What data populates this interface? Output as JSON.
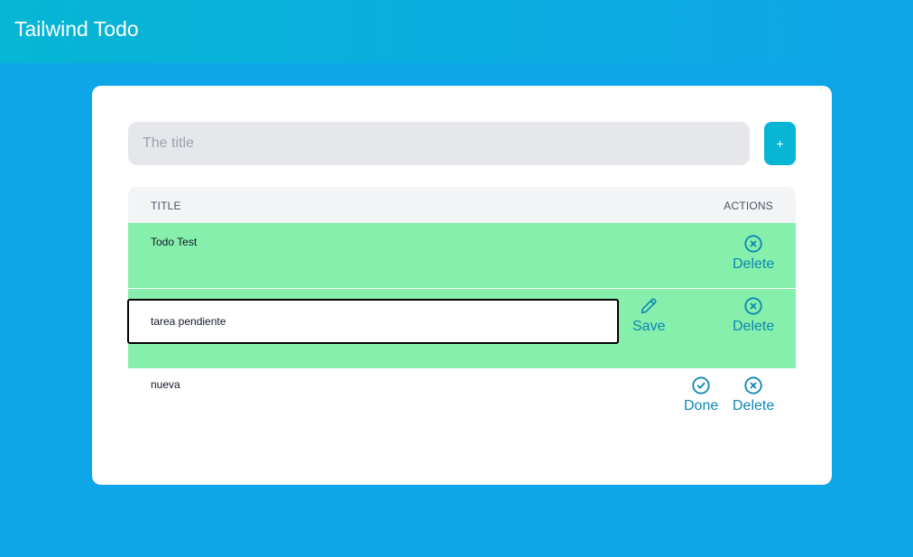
{
  "app": {
    "title": "Tailwind Todo"
  },
  "form": {
    "placeholder": "The title",
    "value": "",
    "add_label": "+"
  },
  "table": {
    "headers": {
      "title": "TITLE",
      "actions": "ACTIONS"
    },
    "rows": [
      {
        "title": "Todo Test",
        "status": "done",
        "delete_label": "Delete"
      },
      {
        "title": "tarea pendiente",
        "status": "editing",
        "save_label": "Save",
        "delete_label": "Delete"
      },
      {
        "title": "nueva",
        "status": "pending",
        "done_label": "Done",
        "delete_label": "Delete"
      }
    ]
  },
  "colors": {
    "background": "#0ea5e9",
    "done_row": "#86efac",
    "accent": "#06b6d4",
    "action_text": "#0e86b3"
  },
  "icons": {
    "delete": "x-circle-icon",
    "save": "pencil-icon",
    "done": "check-circle-icon"
  }
}
